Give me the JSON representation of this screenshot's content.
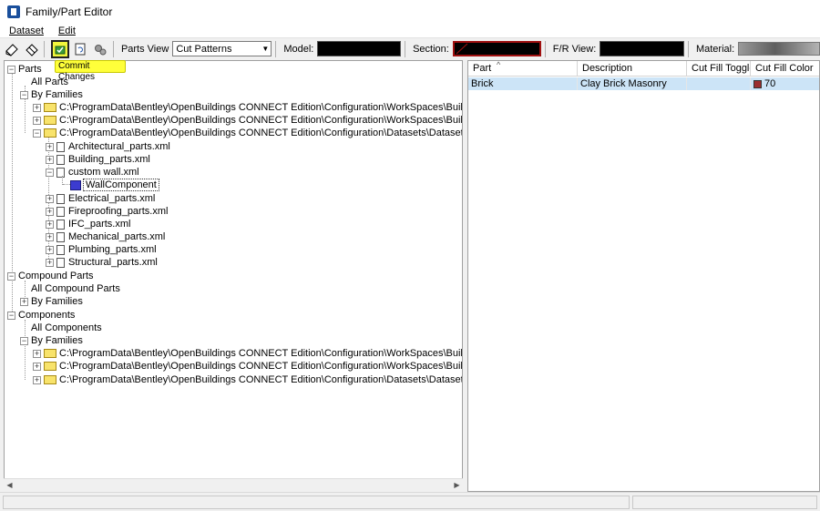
{
  "window": {
    "title": "Family/Part Editor"
  },
  "menu": {
    "items": [
      "Dataset",
      "Edit"
    ]
  },
  "toolbar": {
    "parts_view_label": "Parts View",
    "parts_view_value": "Cut Patterns",
    "model_label": "Model:",
    "section_label": "Section:",
    "fr_view_label": "F/R View:",
    "material_label": "Material:"
  },
  "tooltip": "Commit Changes",
  "tree": {
    "parts": "Parts",
    "all_parts": "All Parts",
    "by_families": "By Families",
    "part_paths": [
      "C:\\ProgramData\\Bentley\\OpenBuildings CONNECT Edition\\Configuration\\WorkSpaces\\Buildi...\\Part\\",
      "C:\\ProgramData\\Bentley\\OpenBuildings CONNECT Edition\\Configuration\\WorkSpaces\\Buildi...\\Part\\",
      "C:\\ProgramData\\Bentley\\OpenBuildings CONNECT Edition\\Configuration\\Datasets\\Dataset_US\\Part\\"
    ],
    "files": [
      "Architectural_parts.xml",
      "Building_parts.xml",
      "custom wall.xml"
    ],
    "wall_component": "WallComponent",
    "files_after": [
      "Electrical_parts.xml",
      "Fireproofing_parts.xml",
      "IFC_parts.xml",
      "Mechanical_parts.xml",
      "Plumbing_parts.xml",
      "Structural_parts.xml"
    ],
    "compound_parts": "Compound Parts",
    "all_compound_parts": "All Compound Parts",
    "compound_by_families": "By Families",
    "components": "Components",
    "all_components": "All Components",
    "components_by_families": "By Families",
    "component_paths": [
      "C:\\ProgramData\\Bentley\\OpenBuildings CONNECT Edition\\Configuration\\WorkSpaces\\Buildi...\\Comp\\",
      "C:\\ProgramData\\Bentley\\OpenBuildings CONNECT Edition\\Configuration\\WorkSpaces\\Buildi...\\Comp\\",
      "C:\\ProgramData\\Bentley\\OpenBuildings CONNECT Edition\\Configuration\\Datasets\\Dataset_US\\Comp\\"
    ]
  },
  "grid": {
    "columns": [
      "Part",
      "Description",
      "Cut Fill Toggle",
      "Cut Fill Color"
    ],
    "sort_indicator": "^",
    "rows": [
      {
        "part": "Brick",
        "description": "Clay Brick Masonry",
        "cut_fill_toggle": "",
        "cut_fill_color": "70",
        "color_hex": "#9b2d2d"
      }
    ]
  },
  "colors": {
    "highlight": "#f2f63c",
    "selection_row": "#cce4f7"
  }
}
